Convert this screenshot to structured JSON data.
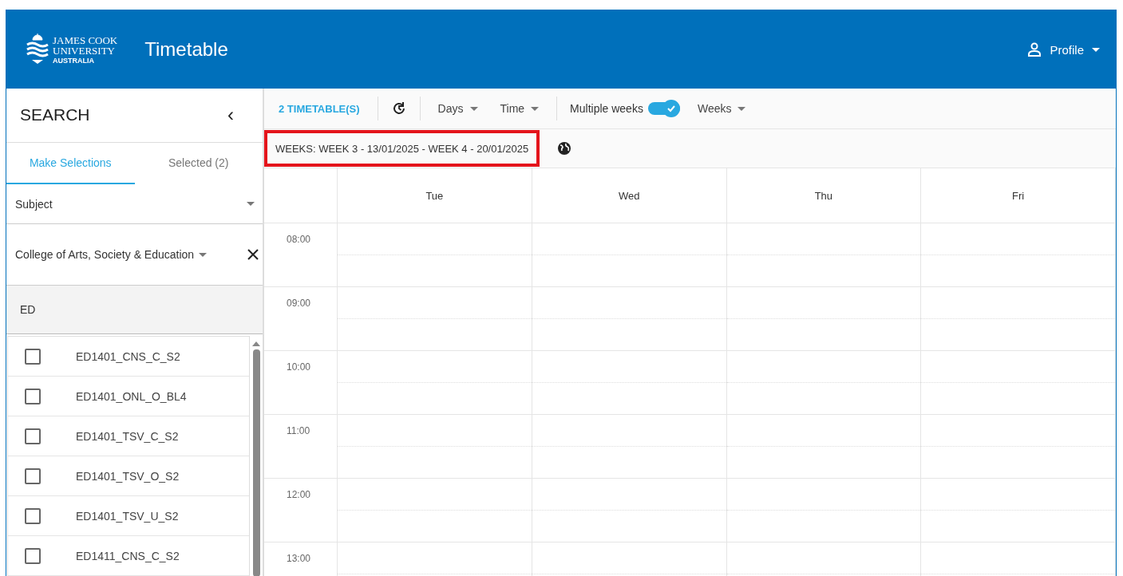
{
  "header": {
    "logo_lines": [
      "JAMES COOK",
      "UNIVERSITY",
      "AUSTRALIA"
    ],
    "title": "Timetable",
    "profile": "Profile"
  },
  "sidebar": {
    "title": "SEARCH",
    "collapse": "‹",
    "tabs": [
      {
        "label": "Make Selections",
        "selected": true
      },
      {
        "label": "Selected (2)",
        "selected": false
      }
    ],
    "type_select": "Subject",
    "college_select": "College of Arts, Society & Education",
    "filter": "ED",
    "items": [
      {
        "label": "ED1401_CNS_C_S2",
        "checked": false
      },
      {
        "label": "ED1401_ONL_O_BL4",
        "checked": false
      },
      {
        "label": "ED1401_TSV_C_S2",
        "checked": false
      },
      {
        "label": "ED1401_TSV_O_S2",
        "checked": false
      },
      {
        "label": "ED1401_TSV_U_S2",
        "checked": false
      },
      {
        "label": "ED1411_CNS_C_S2",
        "checked": false
      }
    ]
  },
  "toolbar": {
    "timetables": "2 TIMETABLE(S)",
    "days": "Days",
    "time": "Time",
    "multiple_weeks": {
      "label": "Multiple weeks",
      "on": true
    },
    "weeks": "Weeks"
  },
  "weeks_chip": {
    "label": "WEEKS: WEEK 3 - 13/01/2025 - WEEK 4 - 20/01/2025",
    "highlighted": true
  },
  "days": [
    "Tue",
    "Wed",
    "Thu",
    "Fri"
  ],
  "times": [
    "08:00",
    "09:00",
    "10:00",
    "11:00",
    "12:00",
    "13:00"
  ]
}
